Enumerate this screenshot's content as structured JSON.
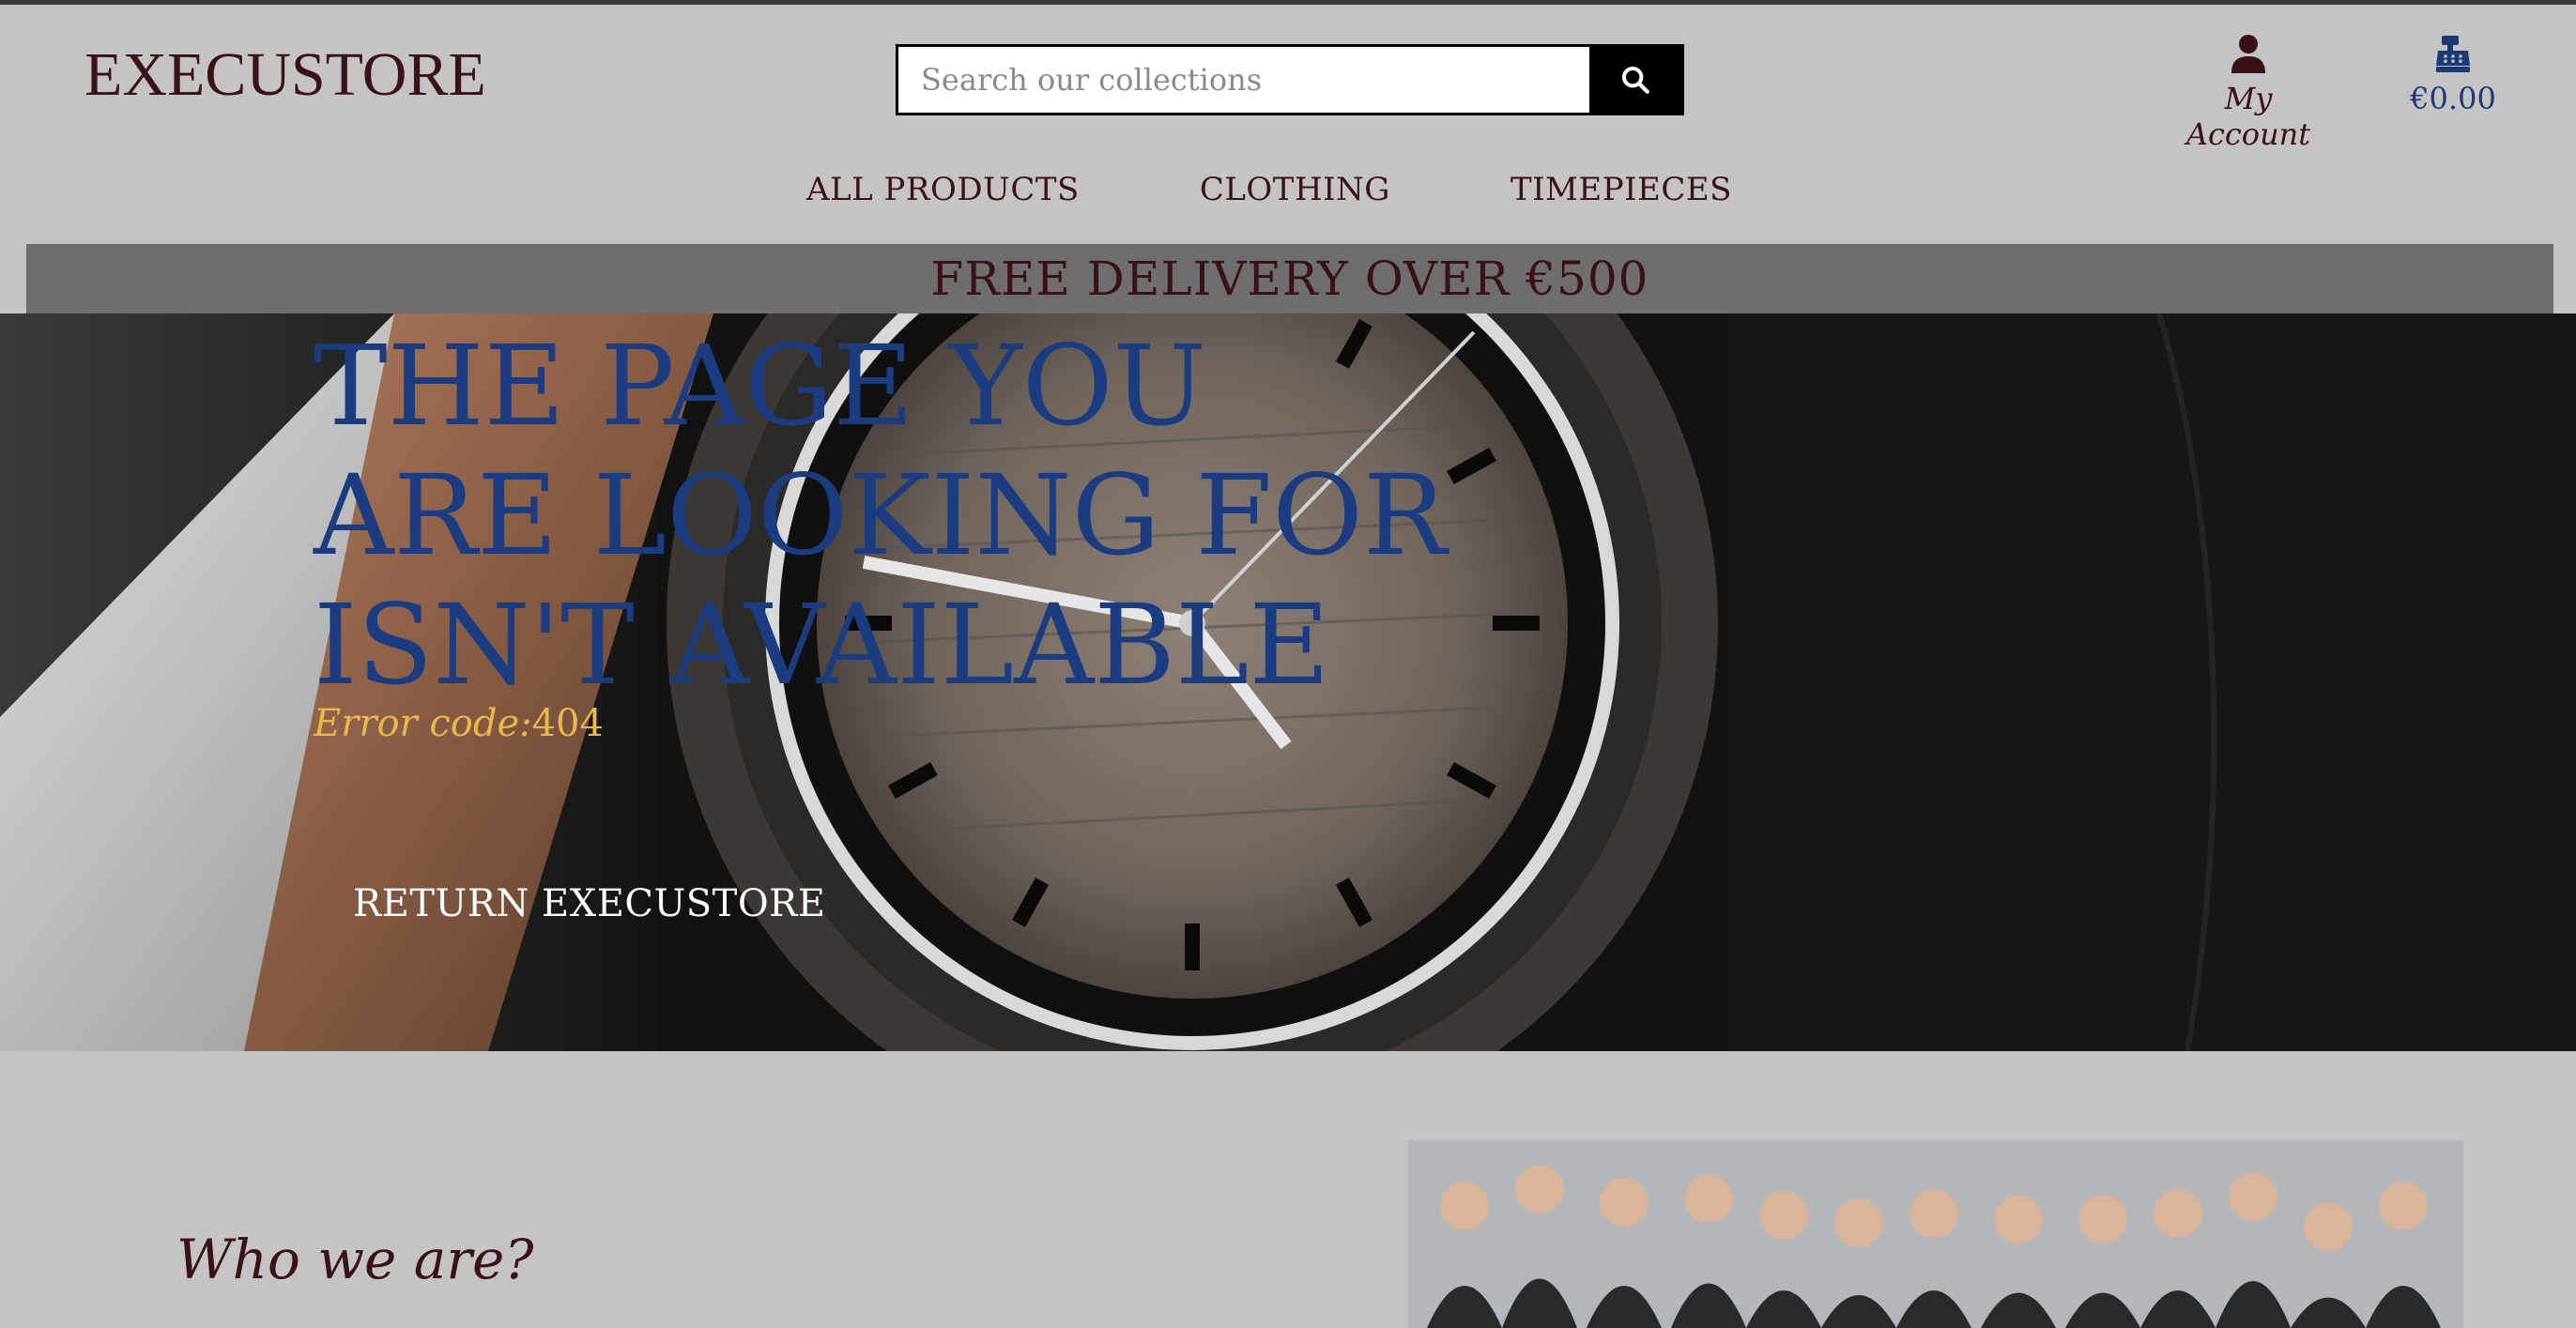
{
  "brand": {
    "name": "EXECUSTORE"
  },
  "search": {
    "placeholder": "Search our collections",
    "icon": "search-icon"
  },
  "header": {
    "account_label": "My Account",
    "account_icon": "user-icon",
    "cart_total": "€0.00",
    "cart_icon": "cash-register-icon"
  },
  "nav": {
    "items": [
      {
        "label": "ALL PRODUCTS"
      },
      {
        "label": "CLOTHING"
      },
      {
        "label": "TIMEPIECES"
      }
    ]
  },
  "promo": {
    "text": "FREE DELIVERY OVER €500"
  },
  "hero": {
    "title_lines": [
      "THE PAGE YOU",
      "ARE LOOKING FOR",
      "ISN'T AVAILABLE"
    ],
    "error_label": "Error code:",
    "error_code": "404",
    "button_label": "RETURN EXECUSTORE"
  },
  "about": {
    "heading": "Who we are?"
  },
  "colors": {
    "background": "#c4c4c4",
    "brand": "#3a1116",
    "accent_blue": "#1b3c80",
    "error_yellow": "#e8b84a",
    "promo_bar": "#6e6e6e"
  }
}
